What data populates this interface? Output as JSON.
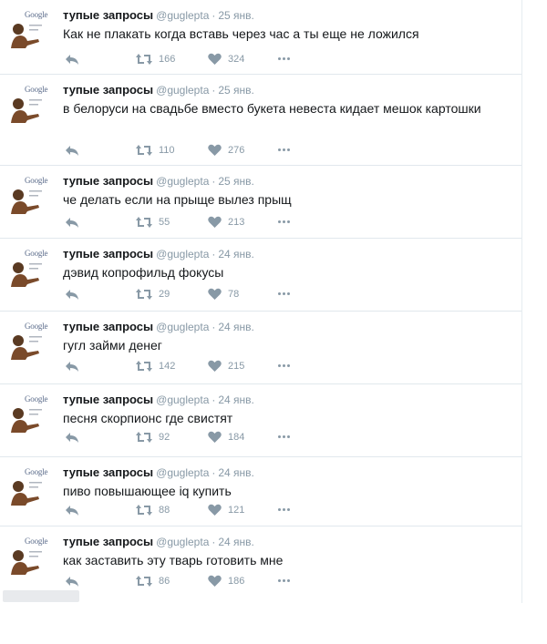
{
  "colors": {
    "text": "#14171a",
    "meta": "#8899a6",
    "divider": "#e1e8ed"
  },
  "icons": {
    "avatar_logo": "Google",
    "reply": "reply-icon",
    "retweet": "retweet-icon",
    "like": "heart-icon",
    "more": "more-icon"
  },
  "tweets": [
    {
      "name": "тупые запросы",
      "handle": "@guglepta",
      "sep": "·",
      "time": "25 янв.",
      "text": "Как не плакать когда вставь через час а ты еще не ложился",
      "retweets": "166",
      "likes": "324"
    },
    {
      "name": "тупые запросы",
      "handle": "@guglepta",
      "sep": "·",
      "time": "25 янв.",
      "text": "в белоруси на свадьбе вместо букета невеста кидает мешок картошки",
      "retweets": "110",
      "likes": "276"
    },
    {
      "name": "тупые запросы",
      "handle": "@guglepta",
      "sep": "·",
      "time": "25 янв.",
      "text": "че делать если на прыще вылез прыщ",
      "retweets": "55",
      "likes": "213"
    },
    {
      "name": "тупые запросы",
      "handle": "@guglepta",
      "sep": "·",
      "time": "24 янв.",
      "text": "дэвид копрофильд фокусы",
      "retweets": "29",
      "likes": "78"
    },
    {
      "name": "тупые запросы",
      "handle": "@guglepta",
      "sep": "·",
      "time": "24 янв.",
      "text": "гугл займи денег",
      "retweets": "142",
      "likes": "215"
    },
    {
      "name": "тупые запросы",
      "handle": "@guglepta",
      "sep": "·",
      "time": "24 янв.",
      "text": "песня скорпионс где свистят",
      "retweets": "92",
      "likes": "184"
    },
    {
      "name": "тупые запросы",
      "handle": "@guglepta",
      "sep": "·",
      "time": "24 янв.",
      "text": "пиво повышающее iq купить",
      "retweets": "88",
      "likes": "121"
    },
    {
      "name": "тупые запросы",
      "handle": "@guglepta",
      "sep": "·",
      "time": "24 янв.",
      "text": "как заставить эту тварь готовить мне",
      "retweets": "86",
      "likes": "186"
    }
  ]
}
